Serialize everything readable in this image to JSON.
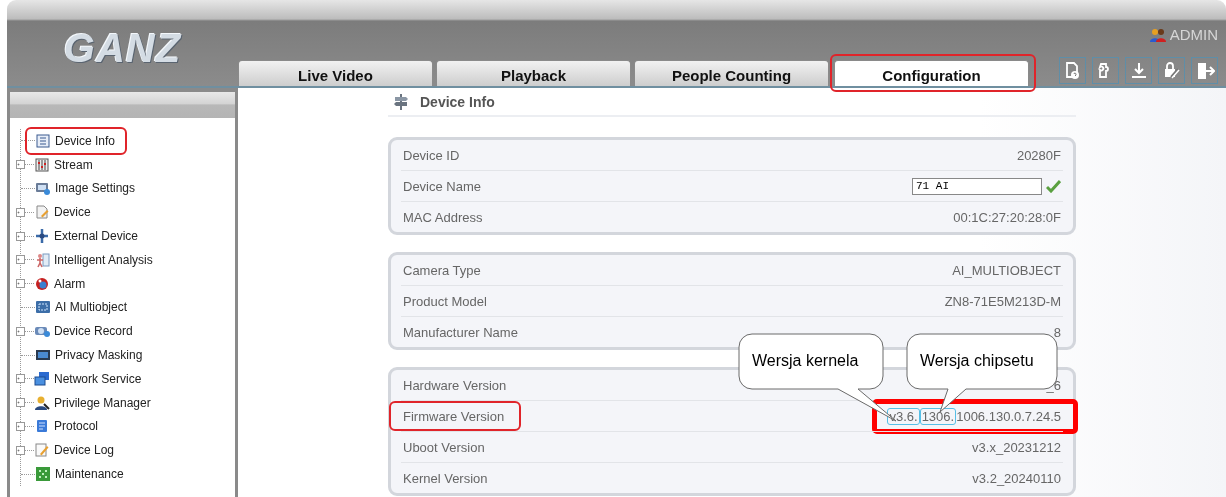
{
  "header": {
    "logo": "GANZ",
    "user": "ADMIN",
    "tabs": [
      {
        "label": "Live Video",
        "selected": false,
        "annotated": false
      },
      {
        "label": "Playback",
        "selected": false,
        "annotated": false
      },
      {
        "label": "People Counting",
        "selected": false,
        "annotated": false
      },
      {
        "label": "Configuration",
        "selected": true,
        "annotated": true
      }
    ]
  },
  "sidebar": {
    "items": [
      {
        "label": "Device Info",
        "expandable": false,
        "annotated": true
      },
      {
        "label": "Stream",
        "expandable": true,
        "annotated": false
      },
      {
        "label": "Image Settings",
        "expandable": false,
        "annotated": false
      },
      {
        "label": "Device",
        "expandable": true,
        "annotated": false
      },
      {
        "label": "External Device",
        "expandable": true,
        "annotated": false
      },
      {
        "label": "Intelligent Analysis",
        "expandable": true,
        "annotated": false
      },
      {
        "label": "Alarm",
        "expandable": true,
        "annotated": false
      },
      {
        "label": "AI Multiobject",
        "expandable": false,
        "annotated": false
      },
      {
        "label": "Device Record",
        "expandable": true,
        "annotated": false
      },
      {
        "label": "Privacy Masking",
        "expandable": false,
        "annotated": false
      },
      {
        "label": "Network Service",
        "expandable": true,
        "annotated": false
      },
      {
        "label": "Privilege Manager",
        "expandable": true,
        "annotated": false
      },
      {
        "label": "Protocol",
        "expandable": true,
        "annotated": false
      },
      {
        "label": "Device Log",
        "expandable": true,
        "annotated": false
      },
      {
        "label": "Maintenance",
        "expandable": false,
        "annotated": false
      }
    ]
  },
  "content": {
    "title": "Device Info",
    "groups": [
      {
        "rows": [
          {
            "kind": "text",
            "label": "Device ID",
            "value": "20280F",
            "annotated": false
          },
          {
            "kind": "input",
            "label": "Device Name",
            "value": "71 AI",
            "valid": true,
            "annotated": false
          },
          {
            "kind": "text",
            "label": "MAC Address",
            "value": "00:1C:27:20:28:0F",
            "annotated": false
          }
        ]
      },
      {
        "rows": [
          {
            "kind": "text",
            "label": "Camera Type",
            "value": "AI_MULTIOBJECT",
            "annotated": false
          },
          {
            "kind": "text",
            "label": "Product Model",
            "value": "ZN8-71E5M213D-M",
            "annotated": false
          },
          {
            "kind": "text",
            "label": "Manufacturer Name",
            "value": "8",
            "annotated": false
          }
        ]
      },
      {
        "rows": [
          {
            "kind": "text",
            "label": "Hardware Version",
            "value": "_6",
            "annotated": false
          },
          {
            "kind": "segments",
            "label": "Firmware Version",
            "annotated": true,
            "highlighted": true,
            "segments": [
              {
                "text": "v3.6.",
                "boxed": true
              },
              {
                "text": "1306.",
                "boxed": true
              },
              {
                "text": "1006.130.0.7.24.5",
                "boxed": false
              }
            ]
          },
          {
            "kind": "text",
            "label": "Uboot Version",
            "value": "v3.x_20231212",
            "annotated": false
          },
          {
            "kind": "text",
            "label": "Kernel Version",
            "value": "v3.2_20240110",
            "annotated": false
          }
        ]
      }
    ]
  },
  "callouts": [
    {
      "text": "Wersja kernela"
    },
    {
      "text": "Wersja chipsetu"
    }
  ]
}
